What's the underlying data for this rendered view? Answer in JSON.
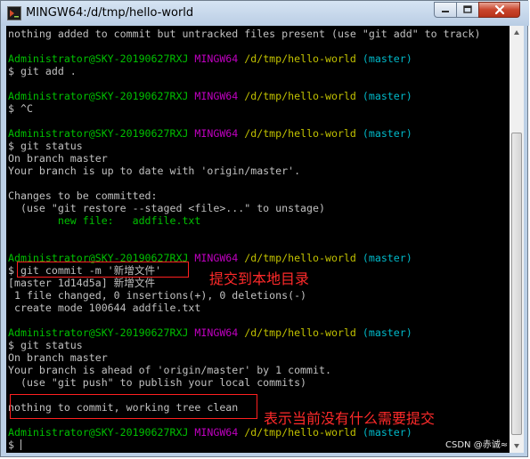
{
  "window": {
    "title": "MINGW64:/d/tmp/hello-world",
    "minimize_icon": "minimize-icon",
    "maximize_icon": "maximize-icon",
    "close_icon": "close-icon"
  },
  "terminal": {
    "lines": [
      {
        "plain": "nothing added to commit but untracked files present (use \"git add\" to track)"
      },
      {
        "plain": ""
      },
      {
        "prompt": true,
        "user": "Administrator@SKY-20190627RXJ",
        "env": "MINGW64",
        "path": "/d/tmp/hello-world",
        "branch": "(master)"
      },
      {
        "plain": "$ git add ."
      },
      {
        "plain": ""
      },
      {
        "prompt": true,
        "user": "Administrator@SKY-20190627RXJ",
        "env": "MINGW64",
        "path": "/d/tmp/hello-world",
        "branch": "(master)"
      },
      {
        "plain": "$ ^C"
      },
      {
        "plain": ""
      },
      {
        "prompt": true,
        "user": "Administrator@SKY-20190627RXJ",
        "env": "MINGW64",
        "path": "/d/tmp/hello-world",
        "branch": "(master)"
      },
      {
        "plain": "$ git status"
      },
      {
        "plain": "On branch master"
      },
      {
        "plain": "Your branch is up to date with 'origin/master'."
      },
      {
        "plain": ""
      },
      {
        "plain": "Changes to be committed:"
      },
      {
        "plain": "  (use \"git restore --staged <file>...\" to unstage)"
      },
      {
        "green": "        new file:   addfile.txt"
      },
      {
        "plain": ""
      },
      {
        "plain": ""
      },
      {
        "prompt": true,
        "user": "Administrator@SKY-20190627RXJ",
        "env": "MINGW64",
        "path": "/d/tmp/hello-world",
        "branch": "(master)"
      },
      {
        "plain": "$ git commit -m '新增文件'"
      },
      {
        "plain": "[master 1d14d5a] 新增文件"
      },
      {
        "plain": " 1 file changed, 0 insertions(+), 0 deletions(-)"
      },
      {
        "plain": " create mode 100644 addfile.txt"
      },
      {
        "plain": ""
      },
      {
        "prompt": true,
        "user": "Administrator@SKY-20190627RXJ",
        "env": "MINGW64",
        "path": "/d/tmp/hello-world",
        "branch": "(master)"
      },
      {
        "plain": "$ git status"
      },
      {
        "plain": "On branch master"
      },
      {
        "plain": "Your branch is ahead of 'origin/master' by 1 commit."
      },
      {
        "plain": "  (use \"git push\" to publish your local commits)"
      },
      {
        "plain": ""
      },
      {
        "plain": "nothing to commit, working tree clean"
      },
      {
        "plain": ""
      },
      {
        "prompt": true,
        "user": "Administrator@SKY-20190627RXJ",
        "env": "MINGW64",
        "path": "/d/tmp/hello-world",
        "branch": "(master)"
      },
      {
        "plain": "$ ",
        "cursor": true
      }
    ],
    "colors": {
      "background": "#000000",
      "text": "#c0c0c0",
      "user": "#00c000",
      "env": "#c000c0",
      "path": "#c0c000",
      "branch": "#00b8c8",
      "annotation": "#ff2a2a"
    }
  },
  "annotations": {
    "commit_note": "提交到本地目录",
    "clean_note": "表示当前没有什么需要提交"
  },
  "scrollbar": {
    "up_icon": "scroll-up-arrow-icon",
    "down_icon": "scroll-down-arrow-icon"
  },
  "watermark": "CSDN @赤诚≈"
}
